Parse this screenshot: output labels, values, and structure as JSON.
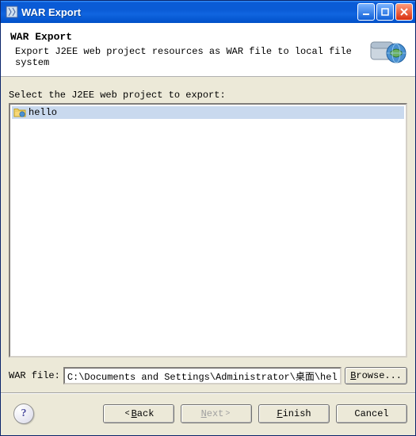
{
  "window": {
    "title": "WAR Export"
  },
  "header": {
    "title": "WAR Export",
    "desc": "Export J2EE web project resources as WAR file to local file system"
  },
  "content": {
    "select_label": "Select the J2EE web project to export:",
    "projects": [
      {
        "name": "hello",
        "selected": true
      }
    ],
    "war_file_label": "WAR file:",
    "war_file_value": "C:\\Documents and Settings\\Administrator\\桌面\\hello.war",
    "browse_label": "Browse..."
  },
  "footer": {
    "back": "Back",
    "next": "Next",
    "finish": "Finish",
    "cancel": "Cancel"
  }
}
